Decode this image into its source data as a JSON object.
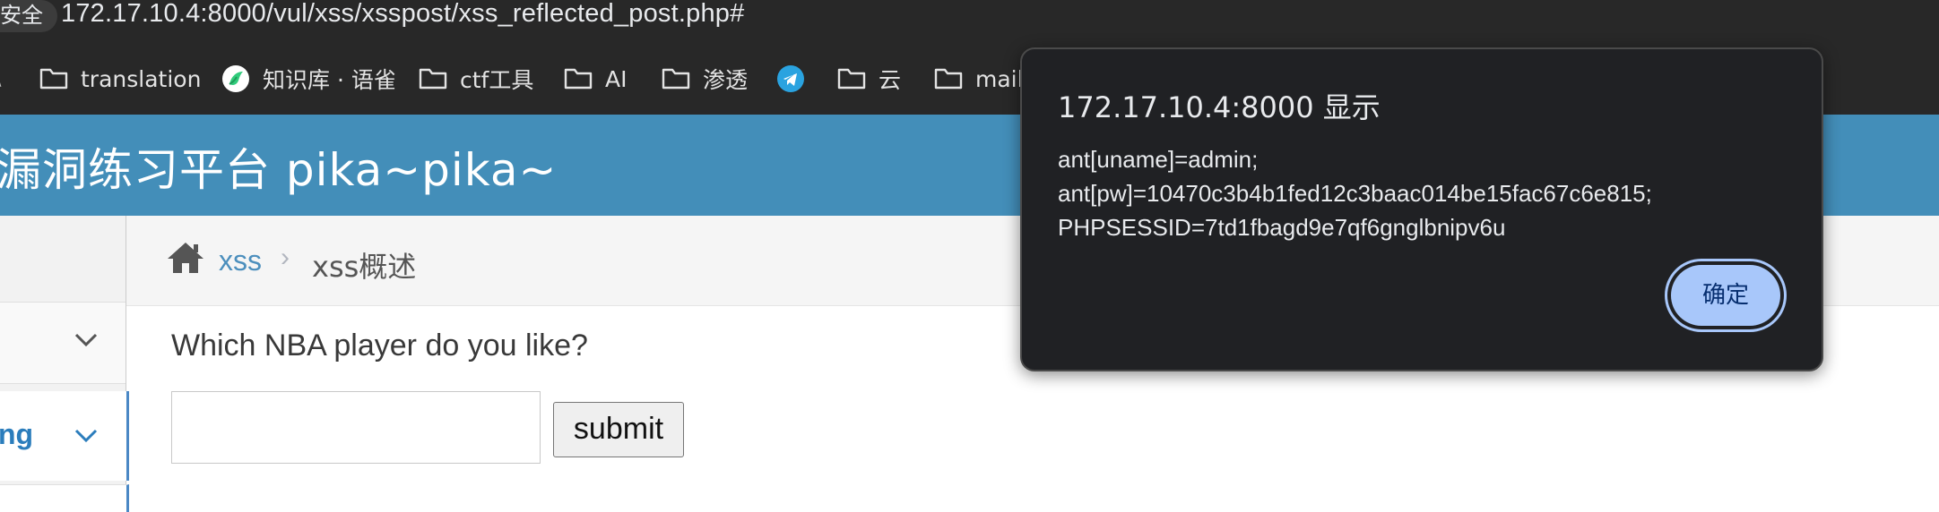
{
  "browser": {
    "security_label": "安全",
    "url": "172.17.10.4:8000/vul/xss/xsspost/xss_reflected_post.php#",
    "bookmarks": [
      {
        "label": "translation",
        "icon": "folder-icon"
      },
      {
        "label": "知识库 · 语雀",
        "icon": "yuque-icon"
      },
      {
        "label": "ctf工具",
        "icon": "folder-icon"
      },
      {
        "label": "AI",
        "icon": "folder-icon"
      },
      {
        "label": "渗透",
        "icon": "folder-icon"
      },
      {
        "label": "",
        "icon": "telegram-icon"
      },
      {
        "label": "云",
        "icon": "folder-icon"
      },
      {
        "label": "mail",
        "icon": "folder-icon"
      }
    ],
    "bookmark_edge_glyph": "\\"
  },
  "site": {
    "title": "漏洞练习平台 pika~pika~",
    "header_color": "#438eb9"
  },
  "sidebar": {
    "active_item_label": "ng"
  },
  "breadcrumb": {
    "link": "xss",
    "separator": "›",
    "current": "xss概述"
  },
  "main": {
    "question": "Which NBA player do you like?",
    "input_value": "",
    "submit_label": "submit"
  },
  "dialog": {
    "title": "172.17.10.4:8000 显示",
    "message": "ant[uname]=admin;\nant[pw]=10470c3b4b1fed12c3baac014be15fac67c6e815;\nPHPSESSID=7td1fbagd9e7qf6gnglbnipv6u",
    "ok_label": "确定",
    "button_color": "#a8c7fa"
  }
}
